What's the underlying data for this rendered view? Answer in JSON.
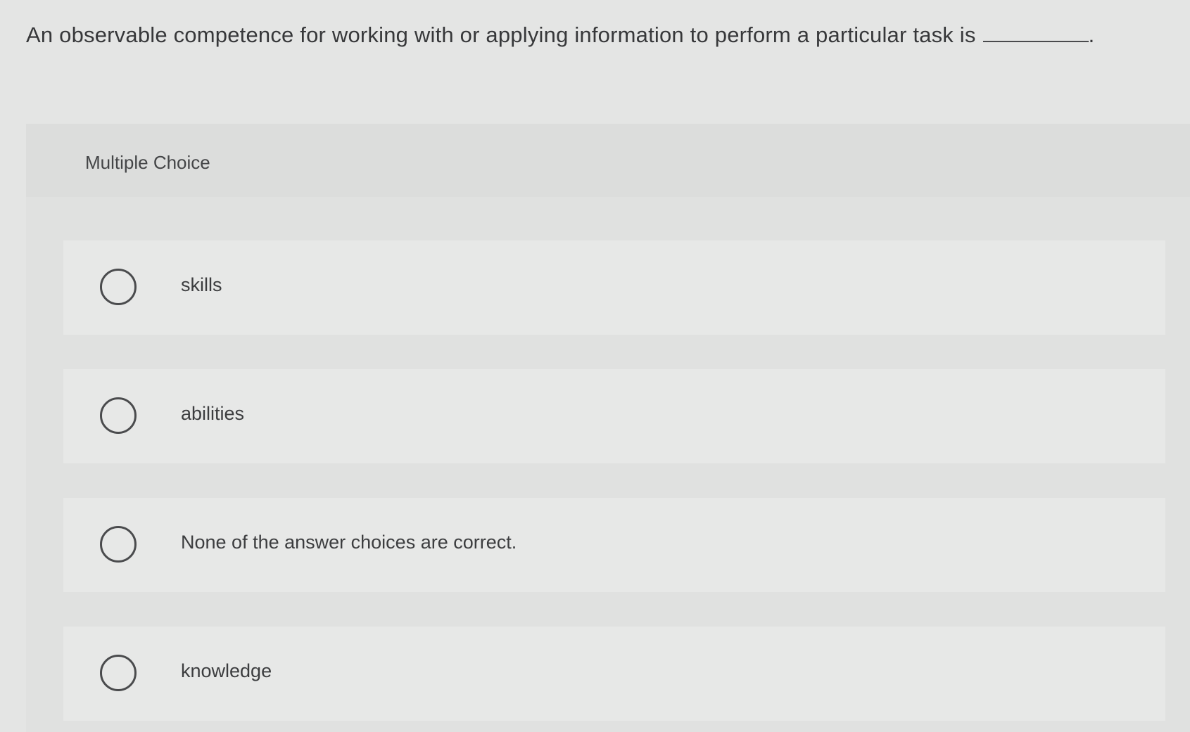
{
  "question": {
    "text": "An observable competence for working with or applying information to perform a particular task is",
    "end_punct": "."
  },
  "panel": {
    "title": "Multiple Choice"
  },
  "options": [
    {
      "label": "skills",
      "selected": false
    },
    {
      "label": "abilities",
      "selected": false
    },
    {
      "label": "None of the answer choices are correct.",
      "selected": false
    },
    {
      "label": "knowledge",
      "selected": false
    }
  ]
}
